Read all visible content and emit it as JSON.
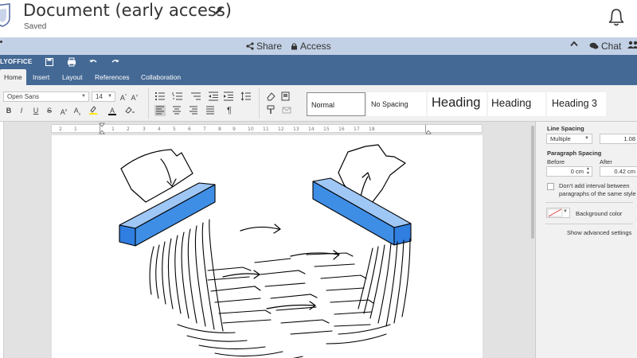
{
  "header": {
    "title": "Document (early access)",
    "status": "Saved"
  },
  "share_bar": {
    "share_label": "Share",
    "access_label": "Access",
    "chat_label": "Chat"
  },
  "editor": {
    "brand": "LYOFFICE",
    "tabs": [
      {
        "label": "Home",
        "active": true
      },
      {
        "label": "Insert",
        "active": false
      },
      {
        "label": "Layout",
        "active": false
      },
      {
        "label": "References",
        "active": false
      },
      {
        "label": "Collaboration",
        "active": false
      }
    ]
  },
  "toolbar": {
    "font_name": "Open Sans",
    "font_size": "14",
    "grow_font": "A",
    "shrink_font": "A",
    "bold": "B",
    "italic": "I",
    "underline": "U",
    "strikethrough": "S",
    "superscript": "A",
    "subscript": "A",
    "font_color": "A",
    "paragraph_mark": "¶",
    "styles": [
      "Normal",
      "No Spacing",
      "Heading",
      "Heading",
      "Heading 3"
    ]
  },
  "ruler": {
    "ticks": [
      "2",
      "1",
      "1",
      "2",
      "3",
      "4",
      "5",
      "6",
      "7",
      "8",
      "9",
      "10",
      "11",
      "12",
      "13",
      "14",
      "15",
      "16",
      "17",
      "18"
    ]
  },
  "right_panel": {
    "line_spacing_title": "Line Spacing",
    "line_spacing_mode": "Multiple",
    "line_spacing_value": "1.08",
    "paragraph_spacing_title": "Paragraph Spacing",
    "before_label": "Before",
    "after_label": "After",
    "before_value": "0 cm",
    "after_value": "0.42 cm",
    "dont_add_interval_line1": "Don't add interval between",
    "dont_add_interval_line2": "paragraphs of the same style",
    "dont_add_interval_checked": false,
    "background_color_label": "Background color",
    "advanced_settings_link": "Show advanced settings"
  },
  "colors": {
    "editor_blue": "#446995",
    "share_bar": "#c3d1e6",
    "shredder_blue": "#3f8ee6"
  }
}
